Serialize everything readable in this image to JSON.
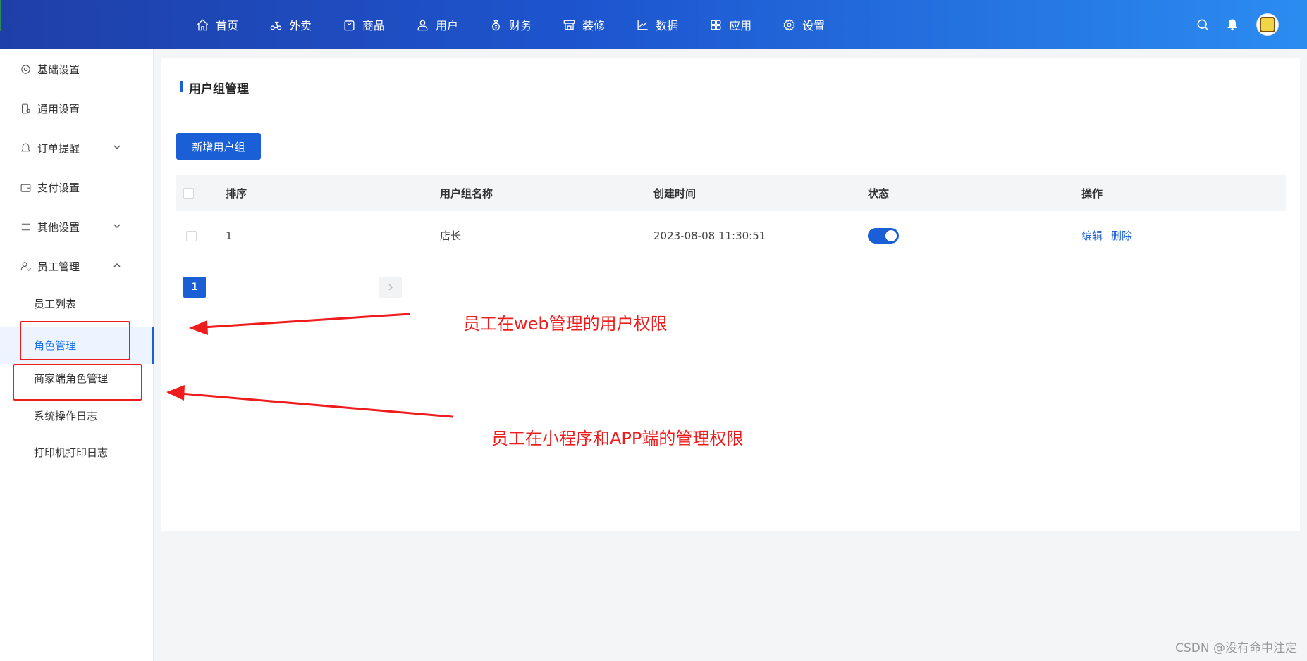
{
  "nav": {
    "items": [
      {
        "label": "首页",
        "icon": "home-icon"
      },
      {
        "label": "外卖",
        "icon": "scooter-icon"
      },
      {
        "label": "商品",
        "icon": "bag-icon"
      },
      {
        "label": "用户",
        "icon": "user-icon"
      },
      {
        "label": "财务",
        "icon": "money-bag-icon"
      },
      {
        "label": "装修",
        "icon": "store-icon"
      },
      {
        "label": "数据",
        "icon": "line-chart-icon"
      },
      {
        "label": "应用",
        "icon": "apps-icon"
      },
      {
        "label": "设置",
        "icon": "gear-icon"
      }
    ]
  },
  "sidebar": {
    "items": [
      {
        "label": "基础设置",
        "icon": "gear-icon"
      },
      {
        "label": "通用设置",
        "icon": "phone-settings-icon"
      },
      {
        "label": "订单提醒",
        "icon": "bell-icon",
        "expandable": true
      },
      {
        "label": "支付设置",
        "icon": "wallet-icon"
      },
      {
        "label": "其他设置",
        "icon": "list-icon",
        "expandable": true
      },
      {
        "label": "员工管理",
        "icon": "staff-icon",
        "expanded": true
      }
    ],
    "subitems": [
      "员工列表",
      "角色管理",
      "商家端角色管理",
      "系统操作日志",
      "打印机打印日志"
    ],
    "active_subitem": "角色管理"
  },
  "page": {
    "title": "用户组管理",
    "add_button": "新增用户组"
  },
  "table": {
    "headers": [
      "排序",
      "用户组名称",
      "创建时间",
      "状态",
      "操作"
    ],
    "rows": [
      {
        "order": "1",
        "name": "店长",
        "created": "2023-08-08 11:30:51",
        "status_on": true,
        "actions": [
          "编辑",
          "删除"
        ]
      }
    ]
  },
  "pager": {
    "current": "1"
  },
  "annotations": {
    "web": "员工在web管理的用户权限",
    "app": "员工在小程序和APP端的管理权限"
  },
  "watermark": "CSDN @没有命中注定",
  "colors": {
    "primary": "#1a5fd6",
    "annotation": "#ee1c1c"
  }
}
